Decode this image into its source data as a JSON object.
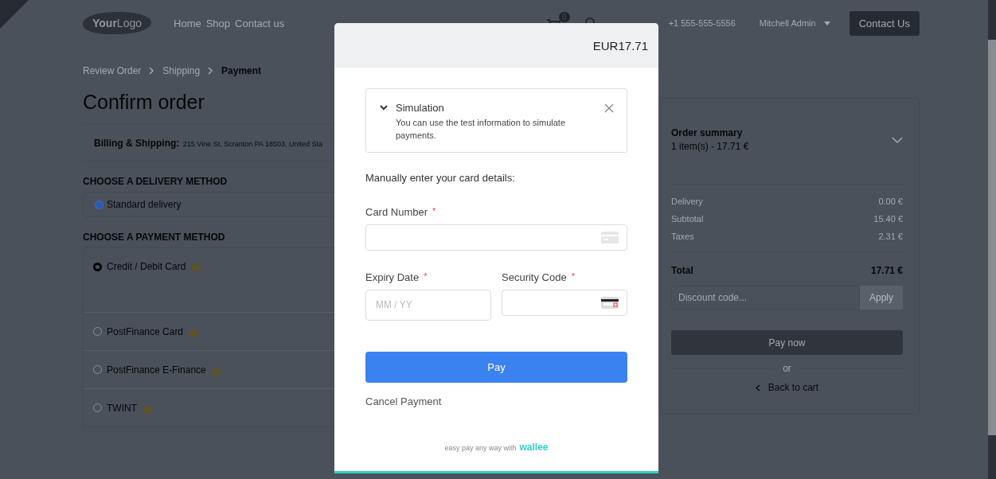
{
  "nav": {
    "logo": "**Your**Logo",
    "links": [
      "Home",
      "Shop",
      "Contact us"
    ],
    "cart_count": "0",
    "phone": "+1 555-555-5556",
    "user": "Mitchell Admin",
    "contact_button": "Contact Us"
  },
  "breadcrumb": [
    {
      "label": "Review Order",
      "selected": false
    },
    {
      "label": "Shipping",
      "selected": false
    },
    {
      "label": "Payment",
      "selected": true
    }
  ],
  "title": "Confirm order",
  "billing": {
    "label": "Billing & Shipping:",
    "address": "215 Vine St, Scranton PA 18503, United Sta"
  },
  "delivery": {
    "heading": "CHOOSE A DELIVERY METHOD",
    "options": [
      {
        "label": "Standard delivery",
        "selected": true
      }
    ]
  },
  "payment": {
    "heading": "CHOOSE A PAYMENT METHOD",
    "options": [
      {
        "label": "Credit / Debit Card",
        "selected": true
      },
      {
        "label": "PostFinance Card",
        "selected": false
      },
      {
        "label": "PostFinance E-Finance",
        "selected": false
      },
      {
        "label": "TWINT",
        "selected": false
      }
    ]
  },
  "summary": {
    "title": "Order summary",
    "count": "1 item(s) -  17.71 €",
    "rows": [
      {
        "label": "Delivery",
        "value": "0.00 €"
      },
      {
        "label": "Subtotal",
        "value": "15.40 €"
      },
      {
        "label": "Taxes",
        "value": "2.31 €"
      }
    ],
    "total": {
      "label": "Total",
      "value": "17.71 €"
    },
    "discount_placeholder": "Discount code...",
    "apply": "Apply",
    "pay_now": "Pay now",
    "or": "or",
    "back": "Back to cart"
  },
  "modal": {
    "amount": "EUR17.71",
    "simulation": {
      "title": "Simulation",
      "text": "You can use the test information to simulate payments.",
      "expanded": true
    },
    "instruction": "Manually enter your card details:",
    "card_number": {
      "label": "Card Number",
      "required_mark": "*"
    },
    "expiry": {
      "label": "Expiry Date",
      "required_mark": "*",
      "placeholder": "MM / YY"
    },
    "security": {
      "label": "Security Code",
      "required_mark": "*"
    },
    "pay": "Pay",
    "cancel": "Cancel Payment",
    "footer": {
      "text": "easy pay any way with",
      "brand": "wallee"
    }
  }
}
